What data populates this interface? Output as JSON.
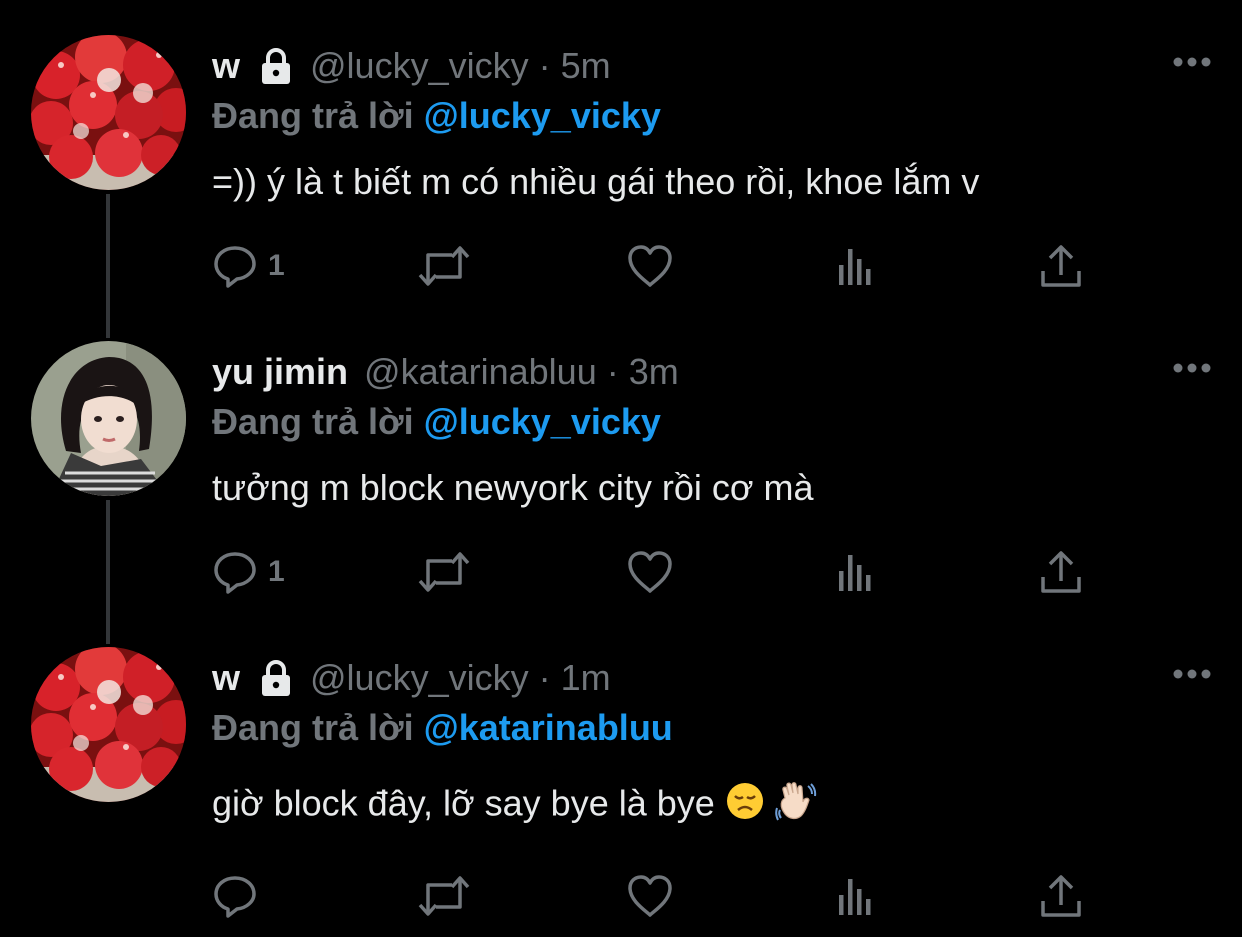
{
  "colors": {
    "background": "#000000",
    "primary_text": "#e7e9ea",
    "secondary_text": "#71767b",
    "accent": "#1d9bf0",
    "thread_line": "#333639"
  },
  "tweets": [
    {
      "display_name": "w",
      "protected": true,
      "handle": "@lucky_vicky",
      "separator": "·",
      "time": "5m",
      "reply_prefix": "Đang trả lời",
      "reply_handle": "@lucky_vicky",
      "text": "=)) ý là t biết m có nhiều gái theo rồi, khoe lắm v",
      "reply_count": "1",
      "avatar_icon": "strawberries-avatar"
    },
    {
      "display_name": "yu jimin",
      "protected": false,
      "handle": "@katarinabluu",
      "separator": "·",
      "time": "3m",
      "reply_prefix": "Đang trả lời",
      "reply_handle": "@lucky_vicky",
      "text": "tưởng m block newyork city rồi cơ mà",
      "reply_count": "1",
      "avatar_icon": "person-photo-avatar"
    },
    {
      "display_name": "w",
      "protected": true,
      "handle": "@lucky_vicky",
      "separator": "·",
      "time": "1m",
      "reply_prefix": "Đang trả lời",
      "reply_handle": "@katarinabluu",
      "text": "giờ block đây, lỡ say bye là bye",
      "reply_count": "",
      "avatar_icon": "strawberries-avatar",
      "text_emojis": [
        "disappointed-face-emoji",
        "waving-hand-emoji"
      ]
    }
  ]
}
